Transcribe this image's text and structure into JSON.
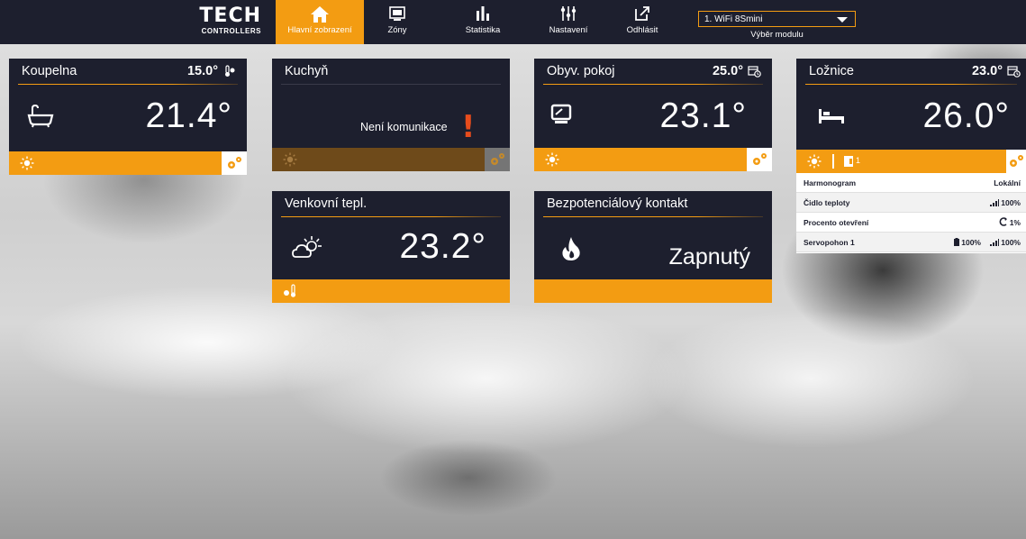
{
  "app": {
    "logo_main": "TECH",
    "logo_sub": "CONTROLLERS"
  },
  "nav": [
    {
      "label": "Hlavní zobrazení",
      "icon": "home-icon",
      "active": true
    },
    {
      "label": "Zóny",
      "icon": "zones-icon",
      "active": false
    },
    {
      "label": "Statistika",
      "icon": "statistics-icon",
      "active": false
    },
    {
      "label": "Nastavení",
      "icon": "settings-sliders-icon",
      "active": false
    },
    {
      "label": "Odhlásit",
      "icon": "logout-icon",
      "active": false
    }
  ],
  "module": {
    "selected": "1. WiFi 8Smini",
    "label": "Výběr modulu"
  },
  "colors": {
    "accent": "#f39c12",
    "tile_bg": "#1d1f2e",
    "alert": "#e74c1c"
  },
  "tiles": {
    "koupelna": {
      "title": "Koupelna",
      "set_temp": "15.0°",
      "set_icon": "thermometer-icon",
      "temp": "21.4°",
      "icon": "bathtub-icon",
      "mode_icon": "sun-icon",
      "gear_icon": "gears-icon"
    },
    "kuchyn": {
      "title": "Kuchyň",
      "message": "Není komunikace",
      "alert": "!",
      "mode_icon": "sun-icon",
      "gear_icon": "gears-icon"
    },
    "obyv": {
      "title": "Obyv. pokoj",
      "set_temp": "25.0°",
      "set_icon": "calendar-clock-icon",
      "temp": "23.1°",
      "icon": "monitor-icon",
      "mode_icon": "sun-icon",
      "gear_icon": "gears-icon"
    },
    "loznice": {
      "title": "Ložnice",
      "set_temp": "23.0°",
      "set_icon": "calendar-clock-icon",
      "temp": "26.0°",
      "icon": "bed-icon",
      "mode_icon": "sun-icon",
      "window_count": "1",
      "gear_icon": "gears-icon"
    },
    "venkovni": {
      "title": "Venkovní tepl.",
      "temp": "23.2°",
      "icon": "weather-sun-cloud-icon",
      "footer_icon": "outdoor-sensor-icon"
    },
    "kontakt": {
      "title": "Bezpotenciálový kontakt",
      "status": "Zapnutý",
      "icon": "flame-icon"
    }
  },
  "detail": {
    "rows": [
      {
        "label": "Harmonogram",
        "value": "Lokální"
      },
      {
        "label": "Čidlo teploty",
        "value": "100%",
        "icon": "signal-icon"
      },
      {
        "label": "Procento otevření",
        "value": "1%",
        "icon": "valve-icon"
      },
      {
        "label": "Servopohon 1",
        "battery": "100%",
        "value": "100%",
        "icon": "signal-icon"
      }
    ]
  }
}
